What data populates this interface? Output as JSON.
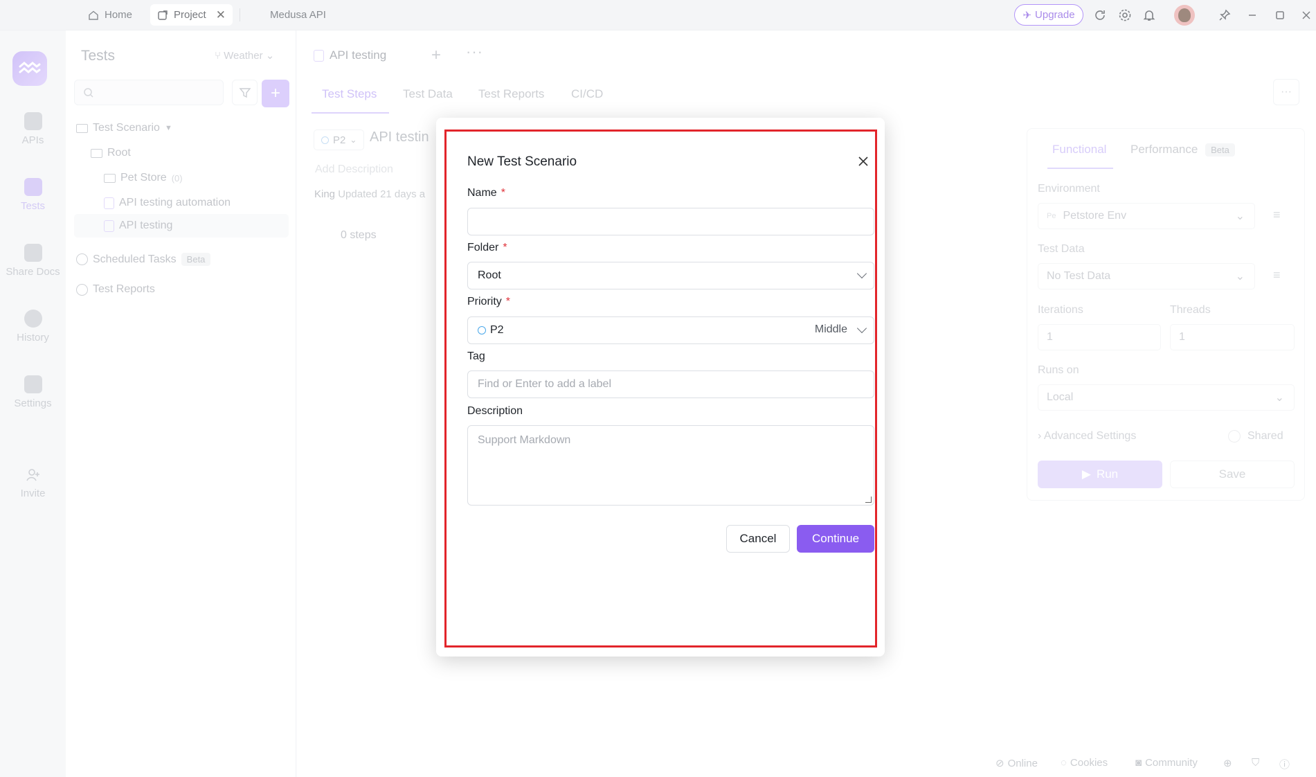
{
  "window": {
    "tabs": [
      {
        "label": "Home"
      },
      {
        "label": "Project"
      },
      {
        "label": "Medusa API"
      }
    ],
    "upgrade_label": "Upgrade"
  },
  "leftnav": {
    "items": [
      {
        "label": "APIs"
      },
      {
        "label": "Tests"
      },
      {
        "label": "Share Docs"
      },
      {
        "label": "History"
      },
      {
        "label": "Settings"
      },
      {
        "label": "Invite"
      }
    ]
  },
  "tests_panel": {
    "title": "Tests",
    "branch": "Weather",
    "tree": [
      {
        "label": "Test Scenario"
      },
      {
        "label": "Root"
      },
      {
        "label": "Pet Store",
        "count": "(0)"
      },
      {
        "label": "API testing automation"
      },
      {
        "label": "API testing"
      },
      {
        "label": "Scheduled Tasks",
        "badge": "Beta"
      },
      {
        "label": "Test Reports"
      }
    ]
  },
  "main": {
    "doc_title": "API testing",
    "subtabs": [
      "Test Steps",
      "Test Data",
      "Test Reports",
      "CI/CD"
    ],
    "priority_chip": "P2",
    "scenario_name": "API testin",
    "add_description": "Add Description",
    "updated_user": "King",
    "updated_text": "Updated 21 days a",
    "steps": "0 steps"
  },
  "run_panel": {
    "tabs": [
      "Functional",
      "Performance"
    ],
    "performance_badge": "Beta",
    "environment_label": "Environment",
    "environment_value": "Petstore Env",
    "environment_prefix": "Pe",
    "test_data_label": "Test Data",
    "test_data_value": "No Test Data",
    "iterations_label": "Iterations",
    "iterations_value": "1",
    "threads_label": "Threads",
    "threads_value": "1",
    "runs_on_label": "Runs on",
    "runs_on_value": "Local",
    "advanced_label": "Advanced Settings",
    "shared_label": "Shared",
    "run_label": "Run",
    "save_label": "Save"
  },
  "footer": {
    "online": "Online",
    "cookies": "Cookies",
    "community": "Community"
  },
  "modal": {
    "title": "New Test Scenario",
    "name_label": "Name",
    "name_value": "",
    "folder_label": "Folder",
    "folder_value": "Root",
    "priority_label": "Priority",
    "priority_value": "P2",
    "priority_level": "Middle",
    "tag_label": "Tag",
    "tag_placeholder": "Find or Enter to add a label",
    "description_label": "Description",
    "description_placeholder": "Support Markdown",
    "required_mark": "*",
    "cancel_label": "Cancel",
    "continue_label": "Continue"
  },
  "colors": {
    "accent": "#8a5cf0",
    "highlight_frame": "#e2252b",
    "required": "#e0333b"
  }
}
